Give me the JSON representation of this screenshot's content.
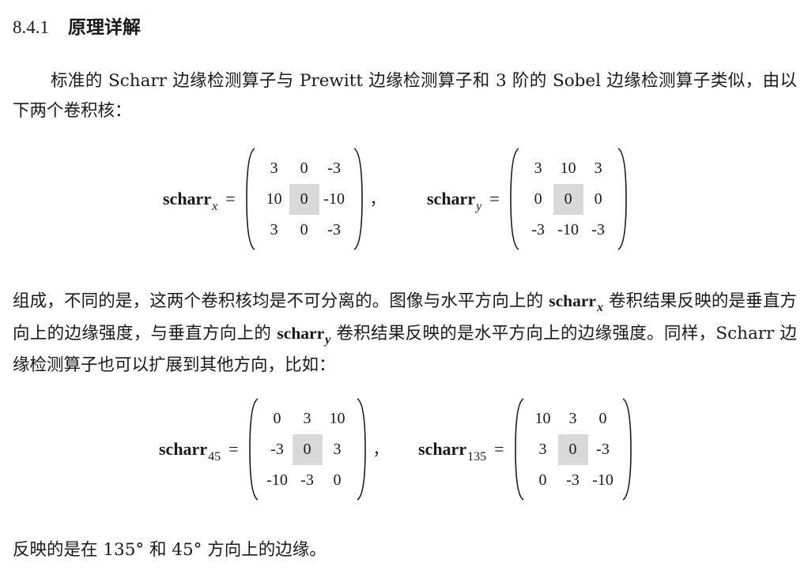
{
  "section": {
    "number": "8.4.1",
    "title": "原理详解"
  },
  "para1": "标准的 Scharr 边缘检测算子与 Prewitt 边缘检测算子和 3 阶的 Sobel 边缘检测算子类似，由以下两个卷积核：",
  "eqs": {
    "sx": {
      "name": "scharr",
      "sub": "x",
      "cells": [
        "3",
        "0",
        "-3",
        "10",
        "0",
        "-10",
        "3",
        "0",
        "-3"
      ]
    },
    "sy": {
      "name": "scharr",
      "sub": "y",
      "cells": [
        "3",
        "10",
        "3",
        "0",
        "0",
        "0",
        "-3",
        "-10",
        "-3"
      ]
    },
    "s45": {
      "name": "scharr",
      "sub": "45",
      "cells": [
        "0",
        "3",
        "10",
        "-3",
        "0",
        "3",
        "-10",
        "-3",
        "0"
      ]
    },
    "s135": {
      "name": "scharr",
      "sub": "135",
      "cells": [
        "10",
        "3",
        "0",
        "3",
        "0",
        "-3",
        "0",
        "-3",
        "-10"
      ]
    }
  },
  "symbols": {
    "equals": "=",
    "comma": "，"
  },
  "para2": {
    "a": "组成，不同的是，这两个卷积核均是不可分离的。图像与水平方向上的 ",
    "var1": "scharr",
    "sub1": "x",
    "b": " 卷积结果反映的是垂直方向上的边缘强度，与垂直方向上的 ",
    "var2": "scharr",
    "sub2": "y",
    "c": " 卷积结果反映的是水平方向上的边缘强度。同样，Scharr 边缘检测算子也可以扩展到其他方向，比如："
  },
  "para3": "反映的是在 135° 和 45° 方向上的边缘。"
}
